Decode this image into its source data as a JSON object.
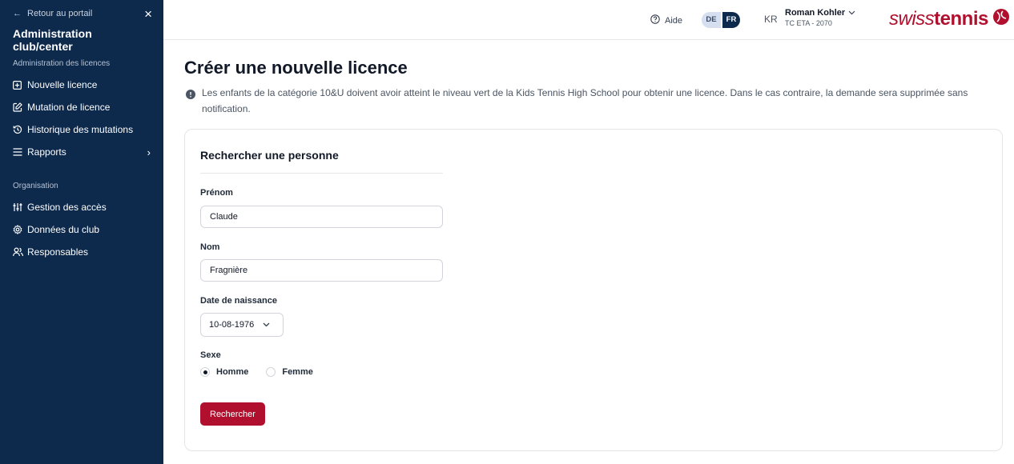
{
  "sidebar": {
    "back_label": "Retour au portail",
    "title": "Administration club/center",
    "sections": [
      {
        "title": "Administration des licences",
        "items": [
          {
            "label": "Nouvelle licence",
            "icon": "plus-square-icon"
          },
          {
            "label": "Mutation de licence",
            "icon": "edit-icon"
          },
          {
            "label": "Historique des mutations",
            "icon": "history-icon"
          },
          {
            "label": "Rapports",
            "icon": "list-icon"
          }
        ]
      },
      {
        "title": "Organisation",
        "items": [
          {
            "label": "Gestion des accès",
            "icon": "sliders-icon"
          },
          {
            "label": "Données du club",
            "icon": "gear-icon"
          },
          {
            "label": "Responsables",
            "icon": "users-icon"
          }
        ]
      }
    ]
  },
  "header": {
    "help_label": "Aide",
    "lang_de": "DE",
    "lang_fr": "FR",
    "active_lang": "FR",
    "user_initials": "KR",
    "user_name": "Roman Kohler",
    "user_club": "TC ETA - 2070",
    "logo_light": "swiss",
    "logo_bold": "tennis"
  },
  "main": {
    "title": "Créer une nouvelle licence",
    "notice": "Les enfants de la catégorie 10&U doivent avoir atteint le niveau vert de la Kids Tennis High School pour obtenir une licence. Dans le cas contraire, la demande sera supprimée sans notification."
  },
  "form": {
    "title": "Rechercher une personne",
    "firstname_label": "Prénom",
    "firstname_value": "Claude",
    "lastname_label": "Nom",
    "lastname_value": "Fragnière",
    "birthdate_label": "Date de naissance",
    "birthdate_value": "10-08-1976",
    "sex_label": "Sexe",
    "sex_options": [
      "Homme",
      "Femme"
    ],
    "sex_selected": "Homme",
    "submit_label": "Rechercher"
  },
  "colors": {
    "sidebar_bg": "#0d2a4d",
    "brand_red": "#b0102e"
  }
}
